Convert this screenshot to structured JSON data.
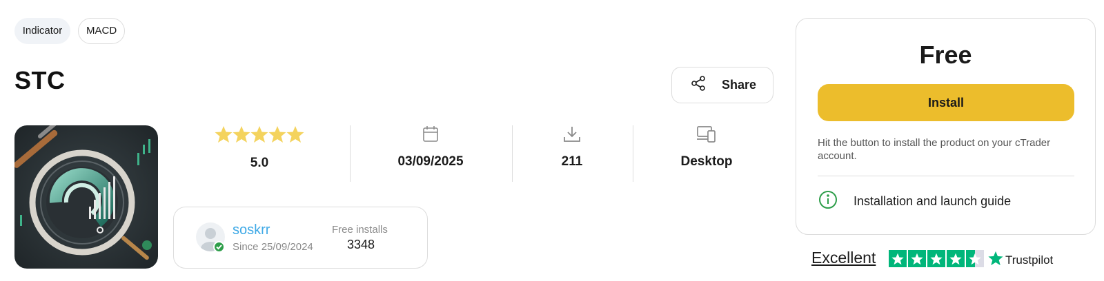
{
  "tags": [
    "Indicator",
    "MACD"
  ],
  "product": {
    "title": "STC",
    "share_label": "Share",
    "image_icon": "stc-product-image"
  },
  "stats": {
    "rating": "5.0",
    "rating_stars": 5,
    "date": "03/09/2025",
    "downloads": "211",
    "platform": "Desktop",
    "icons": [
      "calendar-icon",
      "download-icon",
      "devices-icon"
    ]
  },
  "author": {
    "name": "soskrr",
    "since": "Since 25/09/2024",
    "installs_label": "Free installs",
    "installs_value": "3348"
  },
  "purchase": {
    "price": "Free",
    "install_label": "Install",
    "hint": "Hit the button to install the product on your cTrader account.",
    "guide_label": "Installation and launch guide"
  },
  "trustpilot": {
    "rating_word": "Excellent",
    "brand": "Trustpilot",
    "stars_filled": 4.5
  },
  "colors": {
    "accent_yellow": "#ecbd2c",
    "star_yellow": "#f4d35e",
    "link_blue": "#3fa9e6",
    "verified_green": "#2e9e4a",
    "trustpilot_green": "#00b67a"
  }
}
